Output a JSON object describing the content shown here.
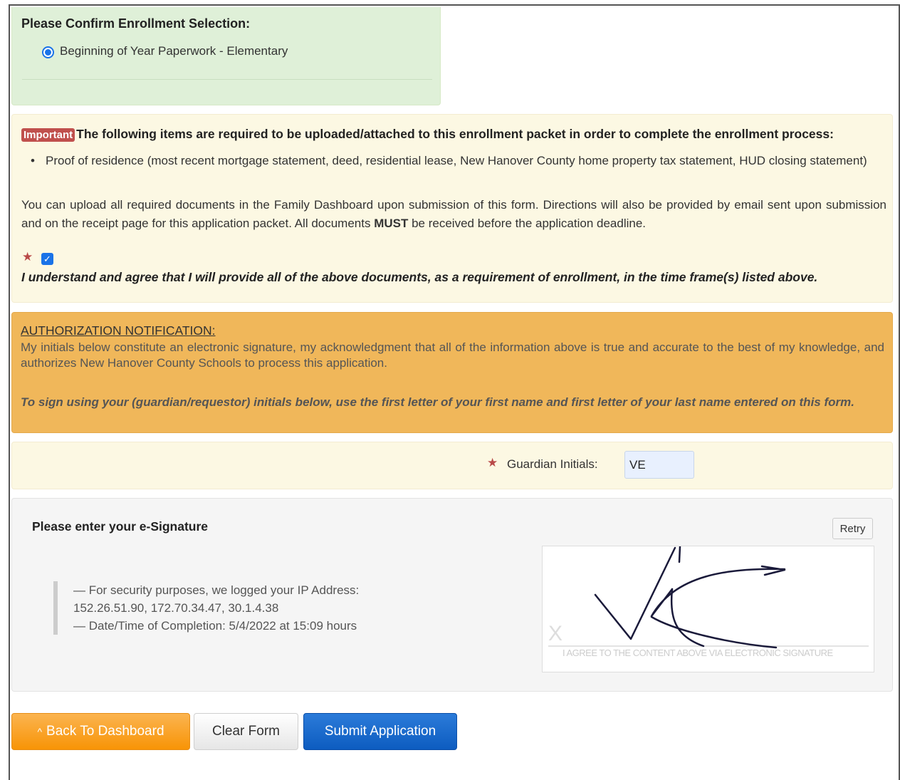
{
  "enrollment": {
    "title": "Please Confirm Enrollment Selection:",
    "option": "Beginning of Year Paperwork - Elementary"
  },
  "important": {
    "badge": "Important",
    "heading": "The following items are required to be uploaded/attached to this enrollment packet in order to complete the enrollment process:",
    "items": [
      "Proof of residence (most recent mortgage statement, deed, residential lease, New Hanover County home property tax statement, HUD closing statement)"
    ],
    "para_before": "You can upload all required documents in the Family Dashboard upon submission of this form. Directions will also be provided by email sent upon submission and on the receipt page for this application packet. All documents ",
    "para_strong": "MUST",
    "para_after": " be received before the application deadline.",
    "star": "★",
    "agree": "I understand and agree that I will provide all of the above documents, as a requirement of enrollment, in the time frame(s) listed above.",
    "checked": true
  },
  "authorization": {
    "title": "AUTHORIZATION NOTIFICATION:",
    "text": "My initials below constitute an electronic signature, my acknowledgment that all of the information above is true and accurate to the best of my knowledge, and authorizes New Hanover County Schools to process this application.",
    "instructions": "To sign using your (guardian/requestor) initials below, use the first letter of your first name and first letter of your last name entered on this form."
  },
  "initials": {
    "star": "★",
    "label": "Guardian Initials:",
    "value": "VE"
  },
  "signature": {
    "title": "Please enter your e-Signature",
    "retry": "Retry",
    "ip_line1": "— For security purposes, we logged your IP Address:",
    "ip_line2": "152.26.51.90, 172.70.34.47, 30.1.4.38",
    "datetime": "— Date/Time of Completion: 5/4/2022 at 15:09 hours",
    "x_mark": "X",
    "caption": "I AGREE TO THE CONTENT ABOVE VIA ELECTRONIC SIGNATURE"
  },
  "buttons": {
    "back_icon": "chevron-up-icon",
    "back_caret": "^",
    "back": "Back To Dashboard",
    "clear": "Clear Form",
    "submit": "Submit Application"
  },
  "colors": {
    "success_bg": "#dff0d8",
    "warning_bg": "#fcf8e3",
    "auth_bg": "#f0b75a",
    "primary": "#1a73e8",
    "danger": "#c0504d",
    "back_button": "#f89406",
    "submit_button": "#0d5cc0"
  }
}
